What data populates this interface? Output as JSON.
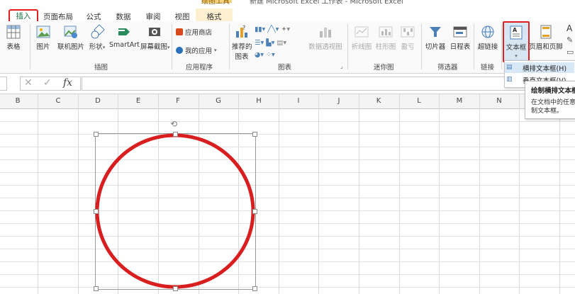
{
  "window": {
    "title": "新建 Microsoft Excel 工作表 - Microsoft Excel",
    "context_tab_group": "绘图工具"
  },
  "tabs": [
    {
      "label": "插入",
      "active": true
    },
    {
      "label": "页面布局"
    },
    {
      "label": "公式"
    },
    {
      "label": "数据"
    },
    {
      "label": "审阅"
    },
    {
      "label": "视图"
    },
    {
      "label": "格式",
      "contextual": true
    }
  ],
  "ribbon": {
    "tables": {
      "table_label": "表格"
    },
    "illustrations": {
      "group_label": "插图",
      "picture": "图片",
      "online_picture": "联机图片",
      "shapes": "形状",
      "smartart": "SmartArt",
      "screenshot": "屏幕截图"
    },
    "apps": {
      "group_label": "应用程序",
      "store": "应用商店",
      "my_apps": "我的应用"
    },
    "charts": {
      "group_label": "图表",
      "recommended_line1": "推荐的",
      "recommended_line2": "图表",
      "pivot_chart": "数据透视图"
    },
    "sparklines": {
      "group_label": "迷你图",
      "line": "折线图",
      "column": "柱形图",
      "winloss": "盈亏"
    },
    "filters": {
      "group_label": "筛选器",
      "slicer": "切片器",
      "timeline": "日程表"
    },
    "links": {
      "group_label": "链接",
      "hyperlink": "超链接"
    },
    "text": {
      "textbox": "文本框",
      "header_footer": "页眉和页脚"
    }
  },
  "textbox_dropdown": {
    "item_horizontal": "横排文本框(H)",
    "item_vertical": "垂直文本框(V)"
  },
  "tooltip": {
    "title": "绘制横排文本框",
    "line1": "在文档中的任意",
    "line2": "制文本框。"
  },
  "formula_bar": {
    "fx": "fx",
    "cancel": "✕",
    "enter": "✓",
    "value": ""
  },
  "columns": [
    "B",
    "C",
    "D",
    "E",
    "F",
    "G",
    "H",
    "I",
    "J",
    "K",
    "L",
    "M",
    "N"
  ],
  "shape": {
    "type": "ellipse",
    "stroke_color": "#d81e1e",
    "fill": "none"
  },
  "colors": {
    "accent_green": "#217346",
    "highlight_red": "#e02020",
    "selection_blue": "#d9e8f7"
  }
}
